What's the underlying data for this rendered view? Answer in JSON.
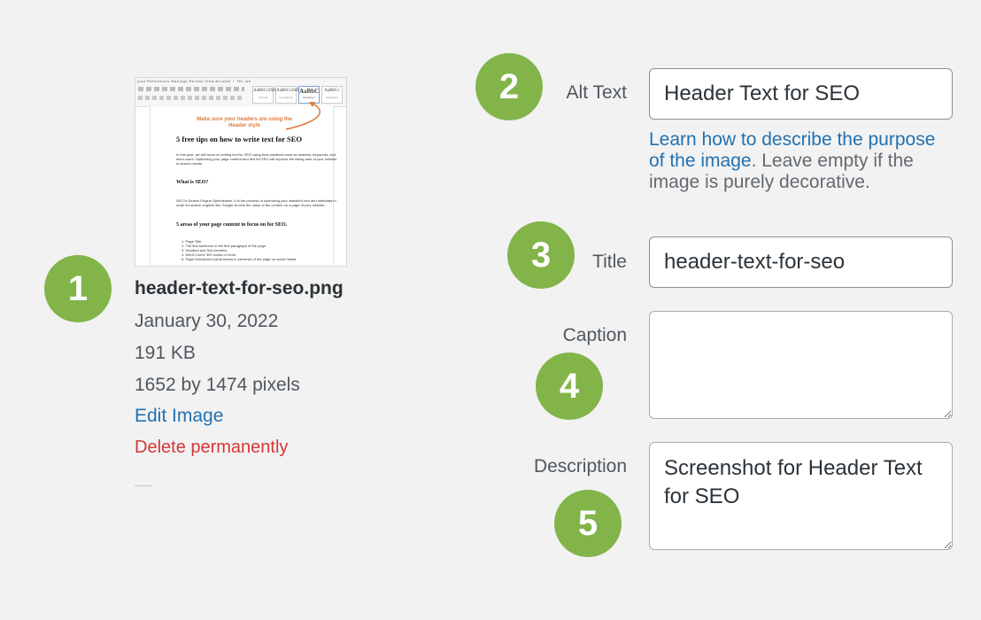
{
  "attachment": {
    "filename": "header-text-for-seo.png",
    "date": "January 30, 2022",
    "filesize": "191 KB",
    "dimensions": "1652 by 1474 pixels",
    "edit_image_label": "Edit Image",
    "delete_label": "Delete permanently",
    "thumbnail": {
      "menu_tabs": "yout   References   Mailings   Review   View   Acrobat   ♀ Tell me",
      "styles": [
        {
          "preview": "AaBbCcDdEe",
          "name": "Normal"
        },
        {
          "preview": "AaBbCcDdEe",
          "name": "No Spacing"
        },
        {
          "preview": "AaBbC",
          "name": "Heading 1"
        },
        {
          "preview": "AaBbCc",
          "name": "Heading 2"
        }
      ],
      "note": "Make sure your headers are using the Header style",
      "heading": "5 free tips on how to write text for SEO",
      "intro": "In this post, we will focus on writing text for SEO using best practices such as headers, keywords, and word count. Optimizing your page content and text for SEO will improve the listing rank of your website in search results.",
      "section1_title": "What is SEO?",
      "section1_text": "SEO is Search Engine Optimization. It is the process of optimizing your website's text and metadata in order for search engines like Google to rank the value of the content on a page of your website.",
      "section2_title": "5 areas of your page content to focus on for SEO.",
      "list": [
        "1.  Page Title",
        "2.  The first sentence in the first paragraph of the page",
        "3.  Headers and Sub-headers",
        "4.  Word Count: 300 words or more",
        "5.  Page Description (what shows in previews of the page on social media"
      ]
    }
  },
  "badges": [
    "1",
    "2",
    "3",
    "4",
    "5"
  ],
  "form": {
    "alt_text": {
      "label": "Alt Text",
      "value": "Header Text for SEO",
      "help_link": "Learn how to describe the purpose of the image",
      "help_rest": ". Leave empty if the image is purely decorative."
    },
    "title": {
      "label": "Title",
      "value": "header-text-for-seo"
    },
    "caption": {
      "label": "Caption",
      "value": ""
    },
    "description": {
      "label": "Description",
      "value": "Screenshot for Header Text for SEO"
    }
  },
  "colors": {
    "badge": "#82b44a",
    "link": "#2271b1",
    "danger": "#d63638",
    "annotation_arrow": "#e07a3b"
  }
}
